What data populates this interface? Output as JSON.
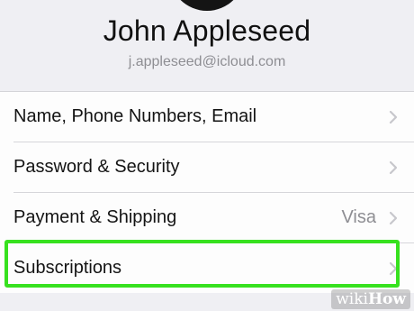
{
  "profile": {
    "name": "John Appleseed",
    "email": "j.appleseed@icloud.com"
  },
  "settings": {
    "rows": [
      {
        "label": "Name, Phone Numbers, Email",
        "value": ""
      },
      {
        "label": "Password & Security",
        "value": ""
      },
      {
        "label": "Payment & Shipping",
        "value": "Visa"
      },
      {
        "label": "Subscriptions",
        "value": ""
      }
    ]
  },
  "watermark": {
    "wiki": "wiki",
    "how": "How"
  },
  "colors": {
    "highlight": "#37e11f",
    "background": "#efeff3",
    "chevron": "#c7c7cc"
  },
  "icons": {
    "disclosure": "chevron-right-icon",
    "profile": "avatar"
  }
}
